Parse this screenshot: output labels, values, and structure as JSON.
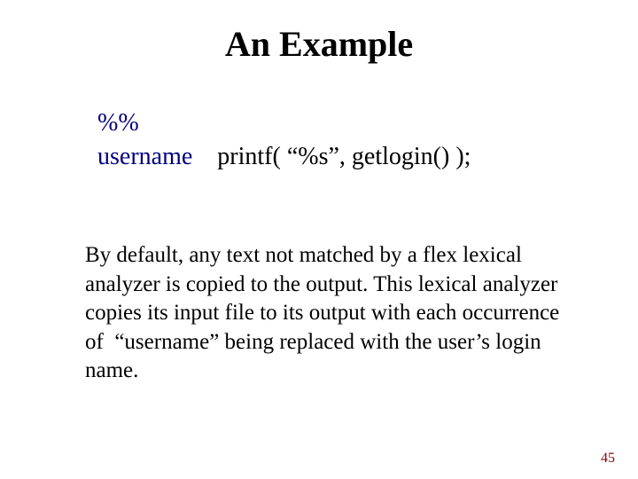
{
  "title": "An Example",
  "code": {
    "line1": "%%",
    "token": "username",
    "action": "printf( “%s”, getlogin() );"
  },
  "body": "By default, any text not matched by a flex lexical analyzer is copied to the output. This lexical analyzer copies its input file to its output with each occurrence of  “username” being replaced with the user’s login name.",
  "page_number": "45"
}
